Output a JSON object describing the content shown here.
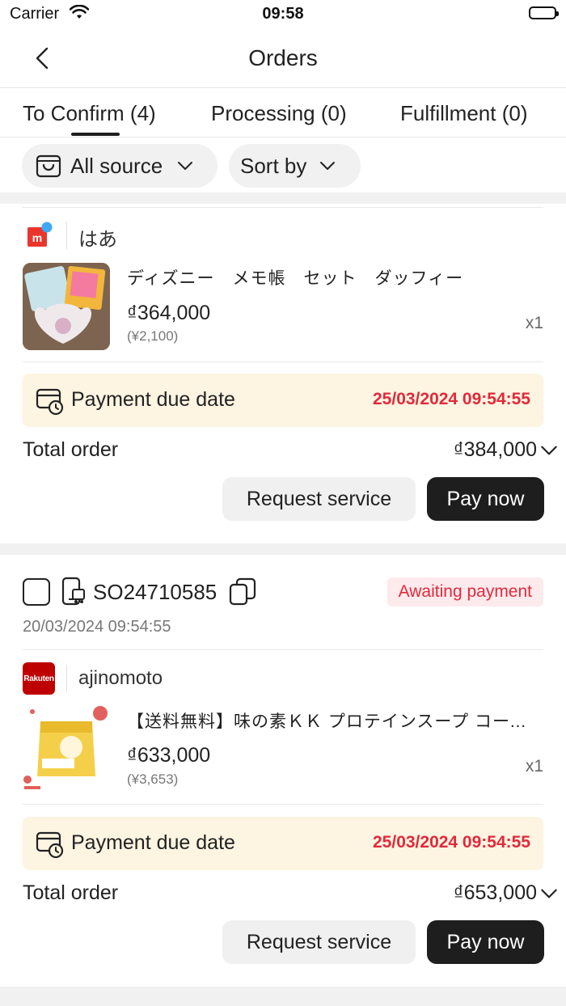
{
  "status_bar": {
    "carrier": "Carrier",
    "time": "09:58"
  },
  "nav": {
    "title": "Orders"
  },
  "tabs": [
    {
      "label": "To Confirm (4)",
      "active": true
    },
    {
      "label": "Processing (0)",
      "active": false
    },
    {
      "label": "Fulfillment (0)",
      "active": false
    }
  ],
  "filters": {
    "source_label": "All source",
    "sort_label": "Sort by"
  },
  "orders": [
    {
      "store": {
        "name": "はあ",
        "logo": "mercari-icon"
      },
      "item": {
        "name": "ディズニー　メモ帳　セット　ダッフィー",
        "price": "₫364,000",
        "price_yen": "(¥2,100)",
        "qty": "x1"
      },
      "due": {
        "label": "Payment due date",
        "date": "25/03/2024 09:54:55"
      },
      "total": {
        "label": "Total order",
        "amount": "₫384,000"
      },
      "buttons": {
        "request": "Request service",
        "pay": "Pay now"
      }
    },
    {
      "order_id": "SO24710585",
      "order_time": "20/03/2024 09:54:55",
      "status": "Awaiting payment",
      "store": {
        "name": "ajinomoto",
        "logo_text": "Rakuten"
      },
      "item": {
        "name": "【送料無料】味の素ＫＫ プロテインスープ コーンクリーム",
        "price": "₫633,000",
        "price_yen": "(¥3,653)",
        "qty": "x1"
      },
      "due": {
        "label": "Payment due date",
        "date": "25/03/2024 09:54:55"
      },
      "total": {
        "label": "Total order",
        "amount": "₫653,000"
      },
      "buttons": {
        "request": "Request service",
        "pay": "Pay now"
      }
    }
  ],
  "colors": {
    "accent_red": "#e02a3c",
    "due_bg": "#fdf4e1",
    "primary_btn": "#1e1e1e",
    "chip_bg": "#f1f1f1"
  }
}
